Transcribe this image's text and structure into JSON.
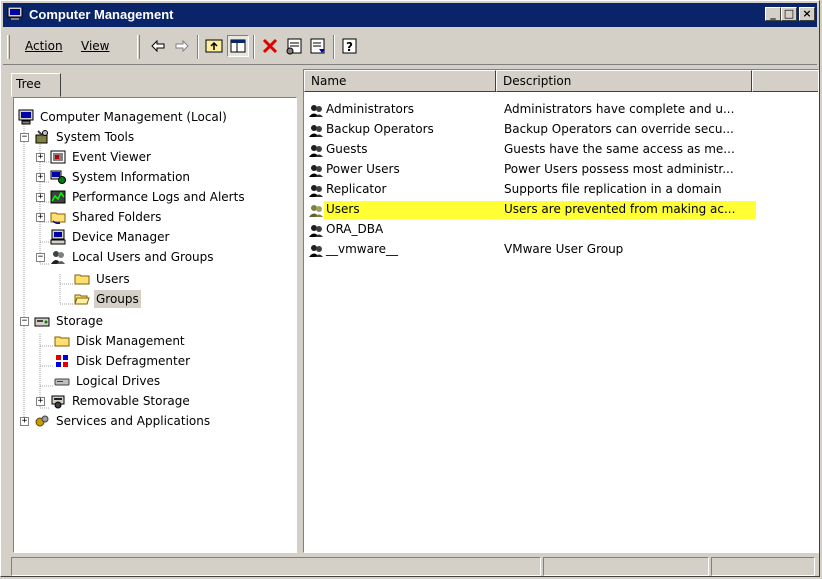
{
  "window": {
    "title": "Computer Management"
  },
  "titlebar_buttons": {
    "minimize": "_",
    "maximize": "□",
    "close": "×"
  },
  "menu": {
    "action": "Action",
    "view": "View"
  },
  "toolbar": {
    "tools": [
      "back-icon",
      "forward-icon",
      "up-folder-icon",
      "show-hide-tree-icon",
      "delete-icon",
      "properties-icon",
      "export-list-icon",
      "help-icon"
    ]
  },
  "tree": {
    "tab_label": "Tree",
    "items": [
      {
        "label": "Computer Management (Local)",
        "icon": "computer-icon"
      },
      {
        "label": "System Tools",
        "icon": "system-tools-icon"
      },
      {
        "label": "Event Viewer",
        "icon": "event-viewer-icon"
      },
      {
        "label": "System Information",
        "icon": "system-information-icon"
      },
      {
        "label": "Performance Logs and Alerts",
        "icon": "performance-icon"
      },
      {
        "label": "Shared Folders",
        "icon": "shared-folder-icon"
      },
      {
        "label": "Device Manager",
        "icon": "device-manager-icon"
      },
      {
        "label": "Local Users and Groups",
        "icon": "users-groups-icon"
      },
      {
        "label": "Users",
        "icon": "folder-icon"
      },
      {
        "label": "Groups",
        "icon": "open-folder-icon"
      },
      {
        "label": "Storage",
        "icon": "storage-icon"
      },
      {
        "label": "Disk Management",
        "icon": "folder-icon"
      },
      {
        "label": "Disk Defragmenter",
        "icon": "defrag-icon"
      },
      {
        "label": "Logical Drives",
        "icon": "drive-icon"
      },
      {
        "label": "Removable Storage",
        "icon": "removable-storage-icon"
      },
      {
        "label": "Services and Applications",
        "icon": "services-icon"
      }
    ],
    "selected": "Groups"
  },
  "list": {
    "columns": [
      "Name",
      "Description"
    ],
    "rows": [
      {
        "name": "Administrators",
        "description": "Administrators have complete and u..."
      },
      {
        "name": "Backup Operators",
        "description": "Backup Operators can override secu..."
      },
      {
        "name": "Guests",
        "description": "Guests have the same access as me..."
      },
      {
        "name": "Power Users",
        "description": "Power Users possess most administr..."
      },
      {
        "name": "Replicator",
        "description": "Supports file replication in a domain"
      },
      {
        "name": "Users",
        "description": "Users are prevented from making ac..."
      },
      {
        "name": "ORA_DBA",
        "description": ""
      },
      {
        "name": "__vmware__",
        "description": "VMware User Group"
      }
    ],
    "highlighted_row": "Users",
    "highlight_color": "#ffff33"
  },
  "colors": {
    "titlebar": "#0a246a",
    "face": "#d4d0c8",
    "window": "#ffffff"
  }
}
